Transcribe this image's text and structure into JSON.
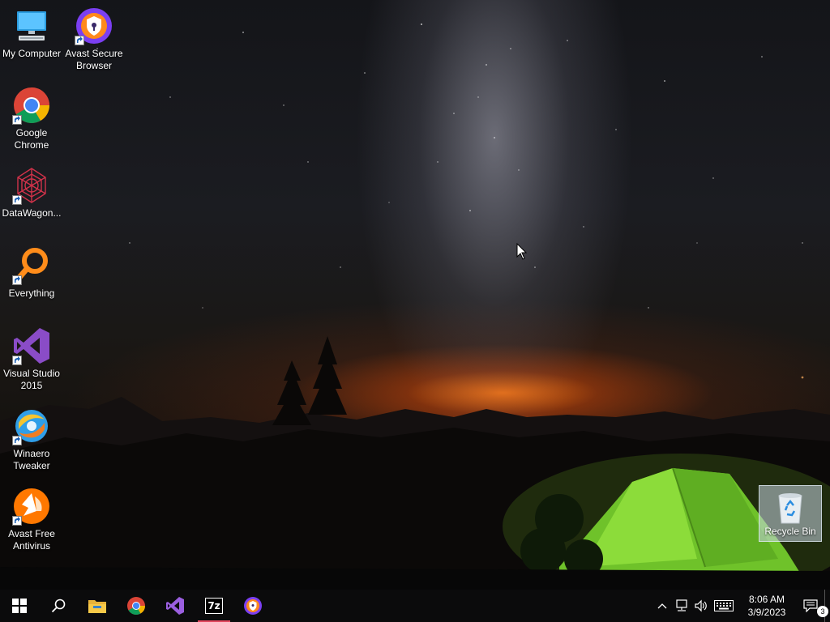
{
  "desktop": {
    "icons": [
      {
        "label": "My Computer",
        "icon": "my-computer-icon"
      },
      {
        "label": "Avast Secure Browser",
        "icon": "avast-secure-browser-icon"
      },
      {
        "label": "Google Chrome",
        "icon": "google-chrome-icon"
      },
      {
        "label": "DataWagon...",
        "icon": "datawagon-icon"
      },
      {
        "label": "Everything",
        "icon": "everything-icon"
      },
      {
        "label": "Visual Studio 2015",
        "icon": "visual-studio-icon"
      },
      {
        "label": "Winaero Tweaker",
        "icon": "winaero-tweaker-icon"
      },
      {
        "label": "Avast Free Antivirus",
        "icon": "avast-antivirus-icon"
      }
    ],
    "recycle_bin": {
      "label": "Recycle Bin",
      "icon": "recycle-bin-icon"
    }
  },
  "taskbar": {
    "apps": [
      {
        "name": "Start",
        "icon": "windows-start-icon"
      },
      {
        "name": "Search",
        "icon": "search-icon"
      },
      {
        "name": "File Explorer",
        "icon": "file-explorer-icon"
      },
      {
        "name": "Google Chrome",
        "icon": "chrome-icon"
      },
      {
        "name": "Visual Studio",
        "icon": "visual-studio-icon"
      },
      {
        "name": "7-Zip",
        "icon": "7zip-icon",
        "label": "7z",
        "active": true
      },
      {
        "name": "Avast Secure Browser",
        "icon": "avast-secure-browser-icon"
      }
    ],
    "tray": {
      "time": "8:06 AM",
      "date": "3/9/2023",
      "notification_count": "3"
    }
  },
  "colors": {
    "taskbar_bg": "#0b0b0c",
    "active_indicator": "#e2465d",
    "selection_bg": "#c8d7e6"
  }
}
